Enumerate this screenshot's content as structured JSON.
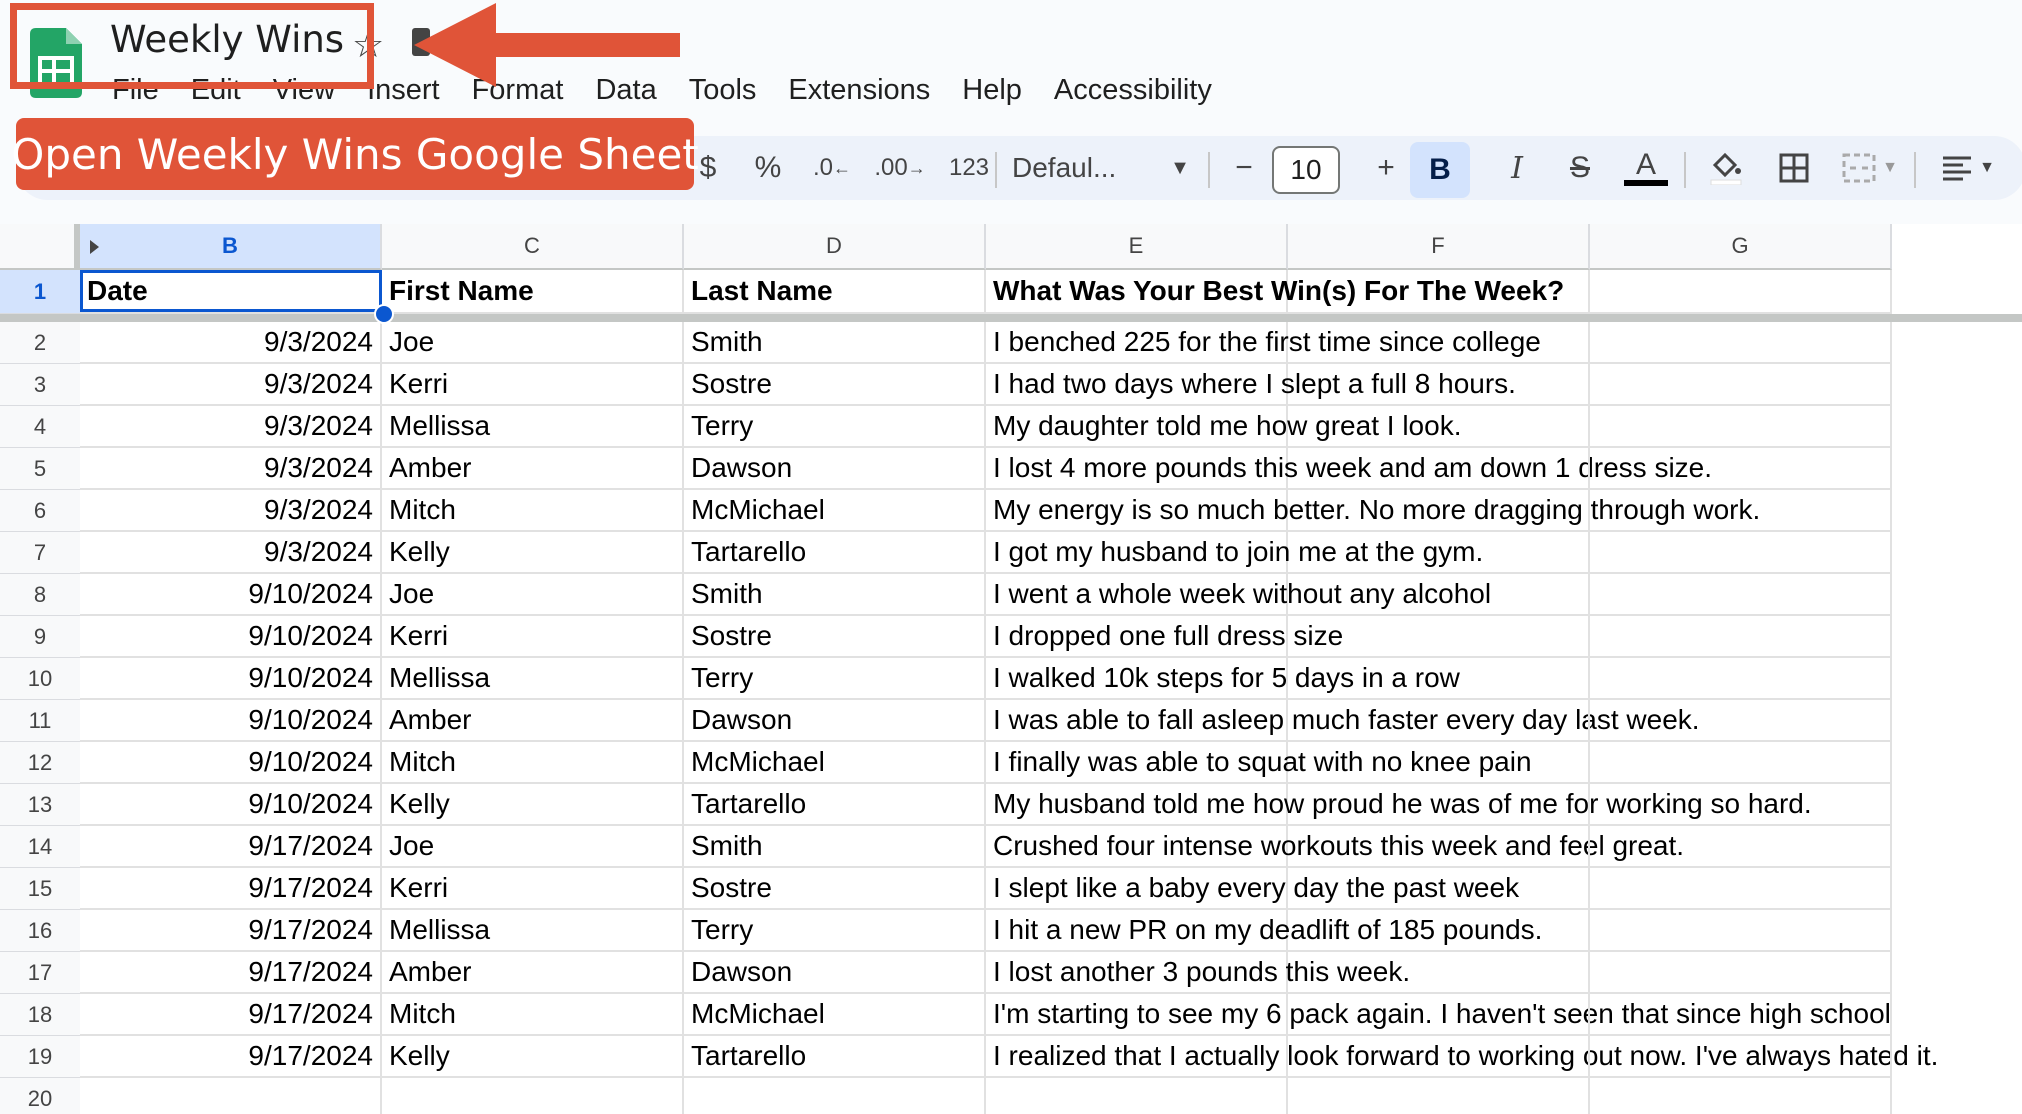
{
  "header": {
    "doc_title": "Weekly Wins",
    "star_icon": "star-icon",
    "move_icon": "move-to-folder-icon"
  },
  "menu": [
    "File",
    "Edit",
    "View",
    "Insert",
    "Format",
    "Data",
    "Tools",
    "Extensions",
    "Help",
    "Accessibility"
  ],
  "toolbar": {
    "currency": "$",
    "percent": "%",
    "decrease_decimal": ".0",
    "increase_decimal": ".00",
    "format_123": "123",
    "font": "Defaul...",
    "font_size": "10",
    "minus": "−",
    "plus": "+",
    "bold": "B",
    "italic": "I",
    "text_color": "A"
  },
  "annotation": {
    "banner_text": "Open Weekly Wins Google Sheet",
    "color": "#e05438"
  },
  "grid": {
    "columns": [
      "B",
      "C",
      "D",
      "E",
      "F",
      "G"
    ],
    "headers": [
      "Date",
      "First Name",
      "Last Name",
      "What Was Your Best Win(s) For The Week?"
    ],
    "row_numbers": [
      "1",
      "2",
      "3",
      "4",
      "5",
      "6",
      "7",
      "8",
      "9",
      "10",
      "11",
      "12",
      "13",
      "14",
      "15",
      "16",
      "17",
      "18",
      "19",
      "20"
    ],
    "rows": [
      [
        "9/3/2024",
        "Joe",
        "Smith",
        "I benched 225 for the first time since college"
      ],
      [
        "9/3/2024",
        "Kerri",
        "Sostre",
        "I had two days where I slept a full 8 hours."
      ],
      [
        "9/3/2024",
        "Mellissa",
        "Terry",
        "My daughter told me how great I look."
      ],
      [
        "9/3/2024",
        "Amber",
        "Dawson",
        "I lost 4 more pounds this week and am down 1 dress size."
      ],
      [
        "9/3/2024",
        "Mitch",
        "McMichael",
        "My energy is so much better. No more dragging through work."
      ],
      [
        "9/3/2024",
        "Kelly",
        "Tartarello",
        "I got my husband to join me at the gym."
      ],
      [
        "9/10/2024",
        "Joe",
        "Smith",
        "I went a whole week without any alcohol"
      ],
      [
        "9/10/2024",
        "Kerri",
        "Sostre",
        "I dropped one full dress size"
      ],
      [
        "9/10/2024",
        "Mellissa",
        "Terry",
        "I walked 10k steps for 5 days in a row"
      ],
      [
        "9/10/2024",
        "Amber",
        "Dawson",
        "I was able to fall asleep much faster every day last week."
      ],
      [
        "9/10/2024",
        "Mitch",
        "McMichael",
        "I finally was able to squat with no knee pain"
      ],
      [
        "9/10/2024",
        "Kelly",
        "Tartarello",
        "My husband told me how proud he was of me for working so hard."
      ],
      [
        "9/17/2024",
        "Joe",
        "Smith",
        "Crushed four intense workouts this week and feel great."
      ],
      [
        "9/17/2024",
        "Kerri",
        "Sostre",
        "I slept like a baby every day the past week"
      ],
      [
        "9/17/2024",
        "Mellissa",
        "Terry",
        "I hit a new PR on my deadlift of 185 pounds."
      ],
      [
        "9/17/2024",
        "Amber",
        "Dawson",
        "I lost another 3 pounds this week."
      ],
      [
        "9/17/2024",
        "Mitch",
        "McMichael",
        "I'm starting to see my 6 pack again. I haven't seen that since high school"
      ],
      [
        "9/17/2024",
        "Kelly",
        "Tartarello",
        "I realized that I actually look forward to working out now. I've always hated it."
      ]
    ]
  }
}
